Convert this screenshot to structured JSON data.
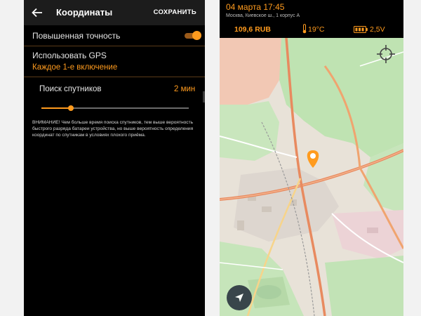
{
  "settings": {
    "title": "Координаты",
    "save_label": "СОХРАНИТЬ",
    "high_accuracy_label": "Повышенная точность",
    "high_accuracy_enabled": true,
    "gps_label": "Использовать GPS",
    "gps_value": "Каждое 1-е включение",
    "satellite_search_label": "Поиск спутников",
    "satellite_search_value": "2 мин",
    "satellite_slider_fraction": 0.2,
    "warning_text": "ВНИМАНИЕ! Чем больше время поиска спутников, тем выше вероятность быстрого разряда батареи устройства, но выше вероятность определения координат по спутникам в условиях плохого приёма."
  },
  "map_screen": {
    "datetime": "04 марта 17:45",
    "address": "Москва, Киевское ш., 1 корпус А",
    "price": "109,6 RUB",
    "temperature": "19°C",
    "voltage": "2,5V"
  },
  "colors": {
    "accent": "#ff9b1e",
    "background": "#000000",
    "park": "#bfe3b2",
    "motorway": "#e88a5f"
  },
  "icons": {
    "back": "back-arrow-icon",
    "thermometer": "thermometer-icon",
    "battery": "battery-icon",
    "locate": "crosshair-icon",
    "navigation": "navigation-arrow-icon",
    "marker": "location-pin-icon"
  }
}
